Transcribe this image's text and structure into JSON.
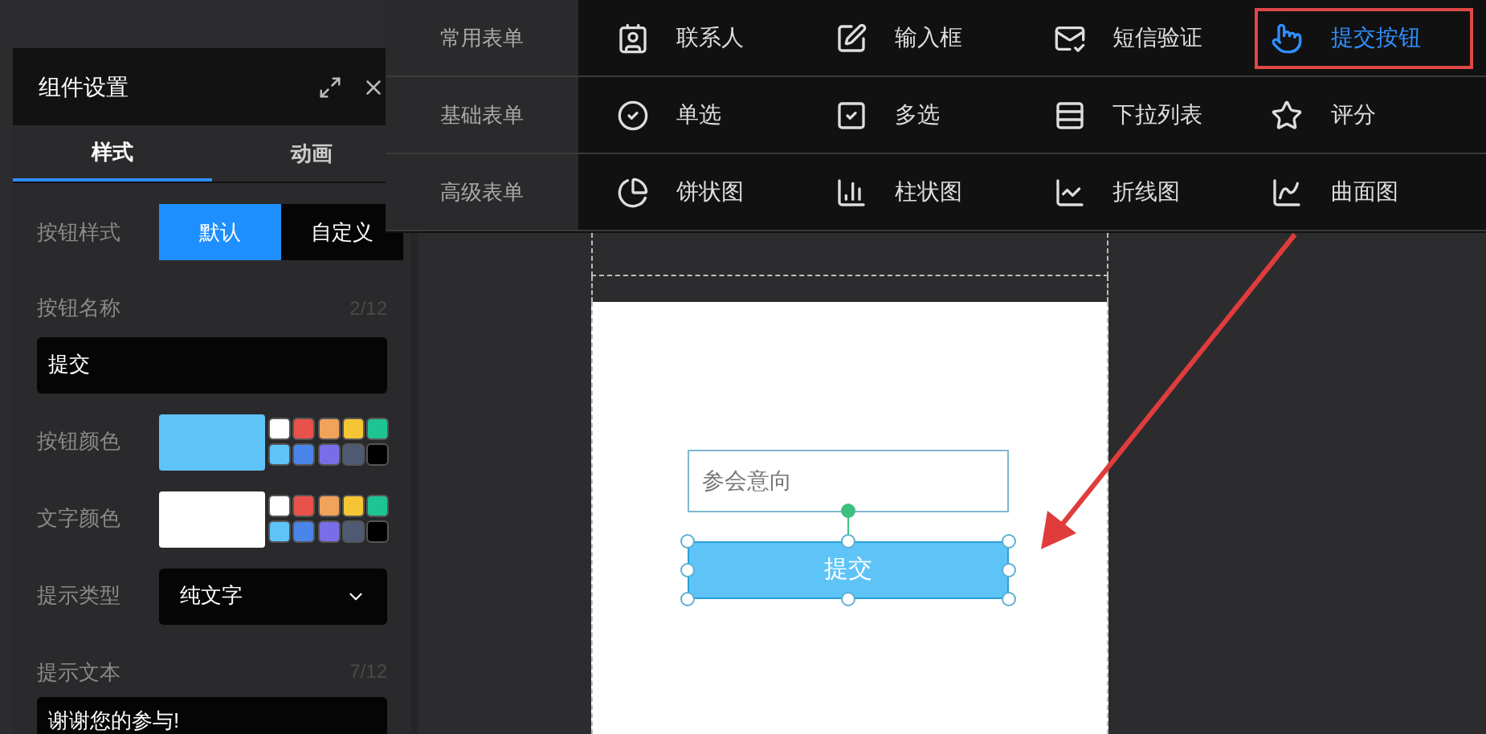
{
  "panel": {
    "title": "组件设置",
    "tabs": [
      {
        "label": "样式",
        "selected": true
      },
      {
        "label": "动画",
        "selected": false
      }
    ],
    "button_style": {
      "label": "按钮样式",
      "options": [
        {
          "label": "默认",
          "selected": true
        },
        {
          "label": "自定义",
          "selected": false
        }
      ]
    },
    "button_name": {
      "label": "按钮名称",
      "count": "2/12",
      "value": "提交"
    },
    "button_color": {
      "label": "按钮颜色",
      "color": "#5ec4f8",
      "swatches": [
        {
          "color": "#ffffff"
        },
        {
          "color": "#e8524a"
        },
        {
          "color": "#f0a35a"
        },
        {
          "color": "#f5c533"
        },
        {
          "color": "#1fc493"
        },
        {
          "color": "#5ec4f8"
        },
        {
          "color": "#4a86e8"
        },
        {
          "color": "#7a6ee8"
        },
        {
          "color": "#4e5a72"
        },
        {
          "color": "#000000"
        }
      ]
    },
    "text_color": {
      "label": "文字颜色",
      "color": "#ffffff",
      "swatches": [
        {
          "color": "#ffffff"
        },
        {
          "color": "#e8524a"
        },
        {
          "color": "#f0a35a"
        },
        {
          "color": "#f5c533"
        },
        {
          "color": "#1fc493"
        },
        {
          "color": "#5ec4f8"
        },
        {
          "color": "#4a86e8"
        },
        {
          "color": "#7a6ee8"
        },
        {
          "color": "#4e5a72"
        },
        {
          "color": "#000000"
        }
      ]
    },
    "hint_type": {
      "label": "提示类型",
      "value": "纯文字"
    },
    "hint_text": {
      "label": "提示文本",
      "count": "7/12",
      "value": "谢谢您的参与!"
    }
  },
  "menu": {
    "rows": [
      {
        "category": "常用表单",
        "items": [
          {
            "label": "联系人",
            "selected": false
          },
          {
            "label": "输入框",
            "selected": false
          },
          {
            "label": "短信验证",
            "selected": false
          },
          {
            "label": "提交按钮",
            "selected": true
          }
        ]
      },
      {
        "category": "基础表单",
        "items": [
          {
            "label": "单选",
            "selected": false
          },
          {
            "label": "多选",
            "selected": false
          },
          {
            "label": "下拉列表",
            "selected": false
          },
          {
            "label": "评分",
            "selected": false
          }
        ]
      },
      {
        "category": "高级表单",
        "items": [
          {
            "label": "饼状图",
            "selected": false
          },
          {
            "label": "柱状图",
            "selected": false
          },
          {
            "label": "折线图",
            "selected": false
          },
          {
            "label": "曲面图",
            "selected": false
          }
        ]
      }
    ]
  },
  "canvas": {
    "field": {
      "placeholder": "参会意向"
    },
    "button": {
      "label": "提交",
      "selected": true
    }
  }
}
